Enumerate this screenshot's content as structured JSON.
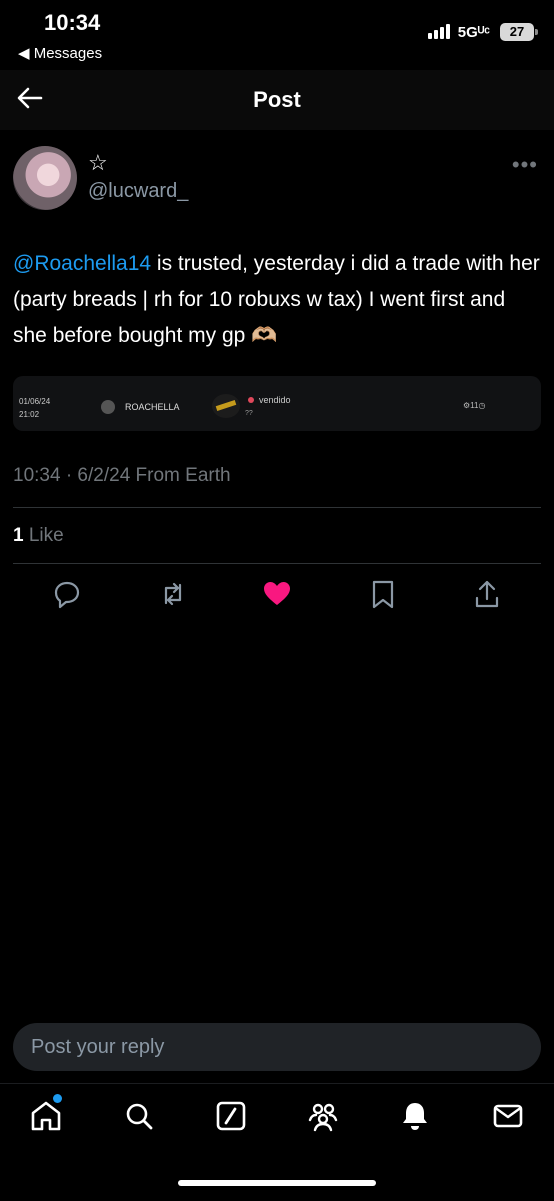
{
  "status_bar": {
    "time": "10:34",
    "back_app": "◀ Messages",
    "network": "5Gᵁᶜ",
    "battery": "27"
  },
  "header": {
    "title": "Post"
  },
  "post": {
    "author_handle": "@lucward_",
    "star_glyph": "☆",
    "mention": "@Roachella14",
    "text": " is trusted, yesterday i did a trade with her (party breads | rh for 10 robuxs w tax) I went first and she before bought my gp 🫶🏼",
    "attachment": {
      "date": "01/06/24",
      "time": "21:02",
      "name": "ROACHELLA",
      "status": "vendido",
      "question": "??",
      "count": "11"
    },
    "meta": "10:34 · 6/2/24 From Earth",
    "likes_count": "1",
    "likes_label": " Like"
  },
  "icons": {
    "reply": "reply-bubble-icon",
    "repost": "repost-icon",
    "like": "heart-icon",
    "bookmark": "bookmark-icon",
    "share": "share-icon"
  },
  "reply": {
    "placeholder": "Post your reply"
  },
  "tabbar": [
    "home-icon",
    "search-icon",
    "grok-icon",
    "communities-icon",
    "notifications-icon",
    "messages-icon"
  ],
  "colors": {
    "accent": "#1d9bf0",
    "like": "#f91880",
    "background": "#000000"
  }
}
